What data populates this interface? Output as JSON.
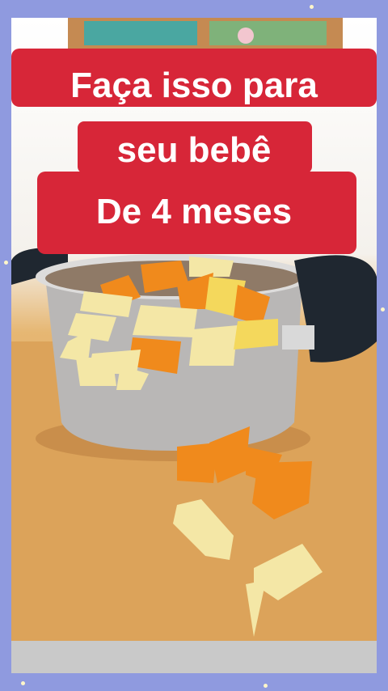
{
  "caption": {
    "line1": "Faça isso para",
    "line2": "seu bebê",
    "line3": "De 4 meses"
  },
  "colors": {
    "frame": "#8f9adf",
    "caption_bg": "#d72638",
    "caption_text": "#ffffff",
    "cutting_board": "#dca35a",
    "pot": "#b9b7b6",
    "pot_handle": "#1f2730",
    "carrot": "#f08a1c",
    "potato": "#f4e7a6"
  },
  "scene": {
    "objects": [
      "window",
      "pot",
      "cutting-board",
      "carrot-pieces",
      "potato-pieces"
    ]
  }
}
